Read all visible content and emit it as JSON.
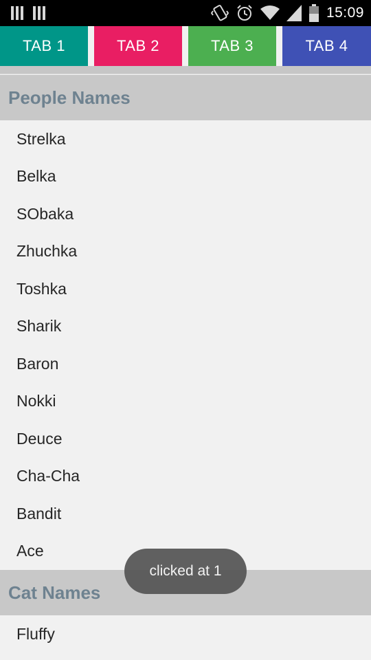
{
  "status_bar": {
    "time": "15:09",
    "icons": [
      "notification-bars-icon",
      "notification-bars-icon",
      "vibrate-icon",
      "alarm-icon",
      "wifi-icon",
      "signal-icon",
      "battery-icon"
    ]
  },
  "tabs": [
    {
      "label": "TAB 1",
      "color": "#009688"
    },
    {
      "label": "TAB 2",
      "color": "#e91e63"
    },
    {
      "label": "TAB 3",
      "color": "#4caf50"
    },
    {
      "label": "TAB 4",
      "color": "#3f51b5"
    }
  ],
  "sections": [
    {
      "title": "People Names",
      "items": [
        "Strelka",
        "Belka",
        "SObaka",
        "Zhuchka",
        "Toshka",
        "Sharik",
        "Baron",
        "Nokki",
        "Deuce",
        "Cha-Cha",
        "Bandit",
        "Ace"
      ]
    },
    {
      "title": "Cat Names",
      "items": [
        "Fluffy"
      ]
    }
  ],
  "toast": {
    "message": "clicked at 1"
  }
}
